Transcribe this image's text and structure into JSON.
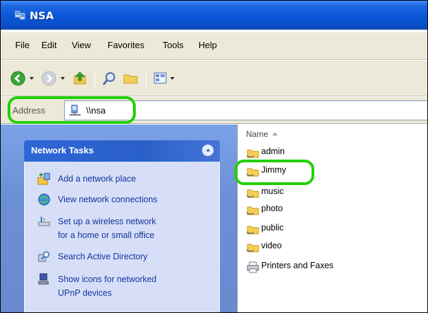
{
  "window": {
    "title": "NSA"
  },
  "menu": [
    "File",
    "Edit",
    "View",
    "Favorites",
    "Tools",
    "Help"
  ],
  "toolbar": {
    "buttons": [
      "back-icon",
      "forward-icon",
      "up-folder-icon",
      "search-icon",
      "folders-icon",
      "views-icon"
    ]
  },
  "address": {
    "label": "Address",
    "value": "\\\\nsa",
    "icon": "network-computer-icon"
  },
  "network_tasks": {
    "title": "Network Tasks",
    "items": [
      {
        "label": "Add a network place",
        "icon": "add-network-place-icon"
      },
      {
        "label": "View network connections",
        "icon": "network-connections-icon"
      },
      {
        "label": "Set up a wireless network",
        "label2": "for a home or small office",
        "icon": "wireless-network-icon"
      },
      {
        "label": "Search Active Directory",
        "icon": "search-directory-icon"
      },
      {
        "label": "Show icons for networked",
        "label2": "UPnP devices",
        "icon": "upnp-devices-icon"
      }
    ]
  },
  "file_list": {
    "column_header": "Name",
    "items": [
      {
        "name": "admin",
        "icon": "shared-folder-icon"
      },
      {
        "name": "Jimmy",
        "icon": "shared-folder-icon"
      },
      {
        "name": "music",
        "icon": "shared-folder-icon"
      },
      {
        "name": "photo",
        "icon": "shared-folder-icon"
      },
      {
        "name": "public",
        "icon": "shared-folder-icon"
      },
      {
        "name": "video",
        "icon": "shared-folder-icon"
      },
      {
        "name": "Printers and Faxes",
        "icon": "printer-icon"
      }
    ]
  },
  "colors": {
    "highlight": "#22d000",
    "title_bar": "#0a55d8",
    "task_pane": "#6b8fd6",
    "task_link": "#15339e"
  }
}
